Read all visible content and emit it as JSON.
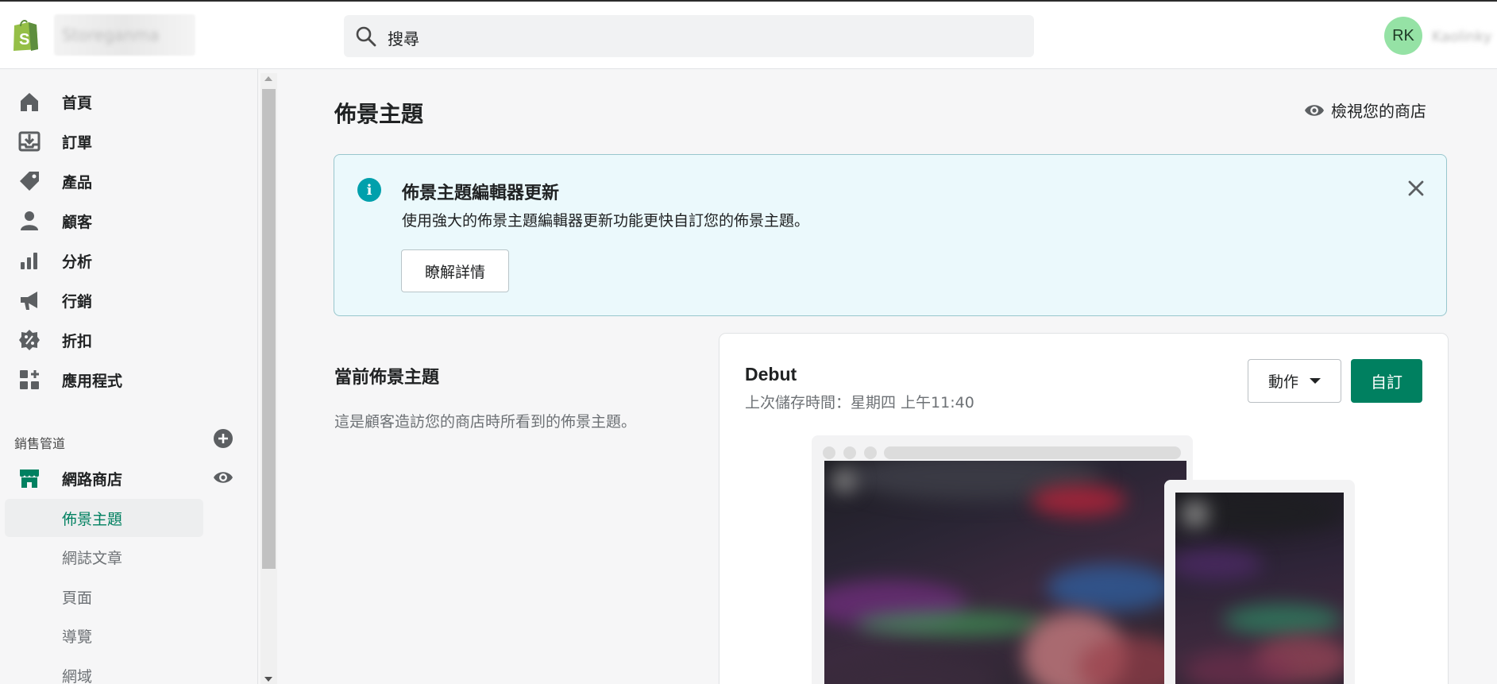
{
  "header": {
    "store_name": "Storeganma",
    "search_placeholder": "搜尋",
    "avatar_initials": "RK",
    "user_name": "Kaolinky"
  },
  "sidebar": {
    "items": [
      {
        "label": "首頁",
        "icon": "home-icon"
      },
      {
        "label": "訂單",
        "icon": "orders-icon"
      },
      {
        "label": "產品",
        "icon": "tag-icon"
      },
      {
        "label": "顧客",
        "icon": "customer-icon"
      },
      {
        "label": "分析",
        "icon": "bar-chart-icon"
      },
      {
        "label": "行銷",
        "icon": "megaphone-icon"
      },
      {
        "label": "折扣",
        "icon": "discount-icon"
      },
      {
        "label": "應用程式",
        "icon": "apps-icon"
      }
    ],
    "channels_label": "銷售管道",
    "online_store": "網路商店",
    "sub_items": [
      {
        "label": "佈景主題",
        "active": true
      },
      {
        "label": "網誌文章",
        "active": false
      },
      {
        "label": "頁面",
        "active": false
      },
      {
        "label": "導覽",
        "active": false
      },
      {
        "label": "網域",
        "active": false
      }
    ]
  },
  "main": {
    "title": "佈景主題",
    "view_store": "檢視您的商店",
    "banner": {
      "title": "佈景主題編輯器更新",
      "description": "使用強大的佈景主題編輯器更新功能更快自訂您的佈景主題。",
      "button": "瞭解詳情"
    },
    "current_theme": {
      "section_title": "當前佈景主題",
      "section_description": "這是顧客造訪您的商店時所看到的佈景主題。",
      "name": "Debut",
      "last_saved": "上次儲存時間：星期四 上午11:40",
      "actions_label": "動作",
      "customize_label": "自訂"
    }
  },
  "colors": {
    "accent": "#008060",
    "banner_bg": "#ebf9fc",
    "info": "#00a0ac",
    "avatar": "#95e2a5"
  }
}
